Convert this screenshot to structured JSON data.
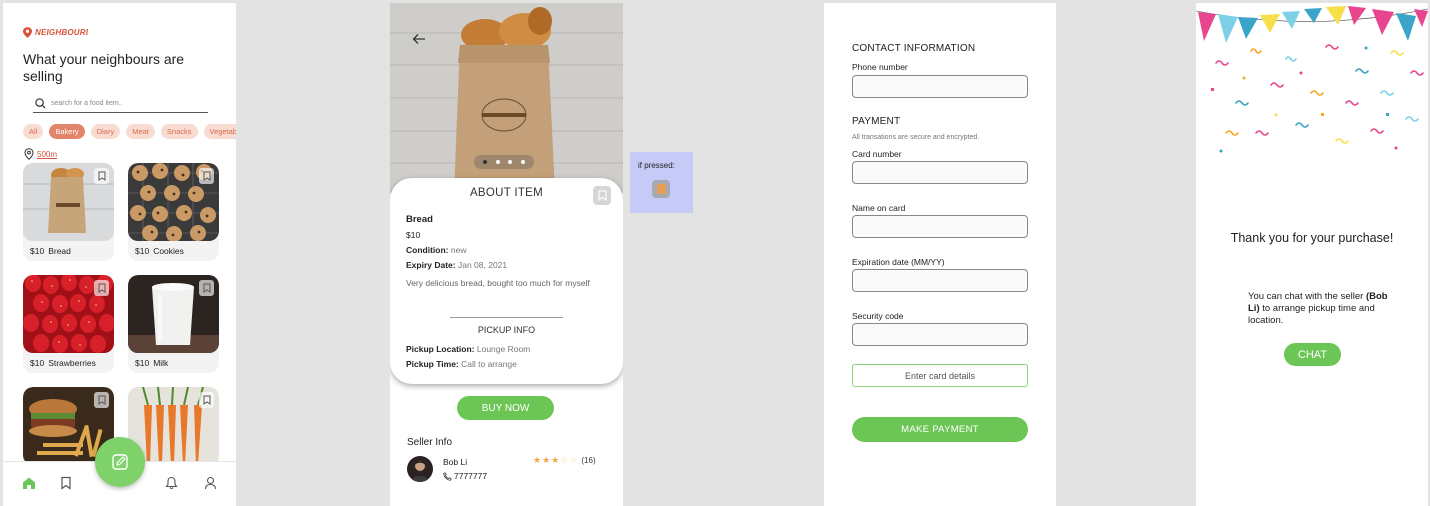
{
  "browse": {
    "brand": "NEIGHBOURI",
    "title": "What your neighbours are selling",
    "search_placeholder": "search for a food item..",
    "categories": [
      "All",
      "Bakery",
      "Diary",
      "Meat",
      "Snacks",
      "Vegetables"
    ],
    "active_category": "Bakery",
    "distance": "500m",
    "items": [
      {
        "price": "$10",
        "name": "Bread"
      },
      {
        "price": "$10",
        "name": "Cookies"
      },
      {
        "price": "$10",
        "name": "Strawberries"
      },
      {
        "price": "$10",
        "name": "Milk"
      }
    ],
    "nav": [
      "home-icon",
      "bookmark-icon",
      "bell-icon",
      "profile-icon"
    ],
    "fab_icon": "edit-icon"
  },
  "item_detail": {
    "about_title": "ABOUT ITEM",
    "name": "Bread",
    "price": "$10",
    "condition_label": "Condition:",
    "condition": "new",
    "expiry_label": "Expiry Date:",
    "expiry": "Jan 08, 2021",
    "description": "Very delicious bread, bought too much for myself",
    "pickup_title": "PICKUP INFO",
    "location_label": "Pickup Location:",
    "location": "Lounge Room",
    "time_label": "Pickup Time:",
    "time": "Call to arrange",
    "buy_label": "BUY NOW",
    "seller_title": "Seller Info",
    "seller_name": "Bob Li",
    "seller_phone": "7777777",
    "rating": 3,
    "rating_max": 5,
    "rating_count": "(16)",
    "carousel_index": 1,
    "carousel_total": 4
  },
  "pressed_note": {
    "label": "if pressed:"
  },
  "payment": {
    "contact_title": "CONTACT INFORMATION",
    "phone_label": "Phone number",
    "payment_title": "PAYMENT",
    "secure_note": "All transations are secure and encrypted.",
    "card_label": "Card number",
    "name_label": "Name on card",
    "expiry_label": "Expiration date (MM/YY)",
    "code_label": "Security code",
    "enter_label": "Enter card details",
    "pay_label": "MAKE PAYMENT"
  },
  "confirmation": {
    "thanks": "Thank you for your purchase!",
    "note_pre": "You can chat with the seller",
    "note_name": "(Bob Li)",
    "note_post": "to arrange pickup time and location.",
    "chat_label": "CHAT"
  },
  "colors": {
    "accent_green": "#6cc655",
    "brand_red": "#d9533e",
    "chip_bg": "#f8dcd2",
    "star": "#f0a63c",
    "pressed_bg": "#c5cbf6"
  }
}
